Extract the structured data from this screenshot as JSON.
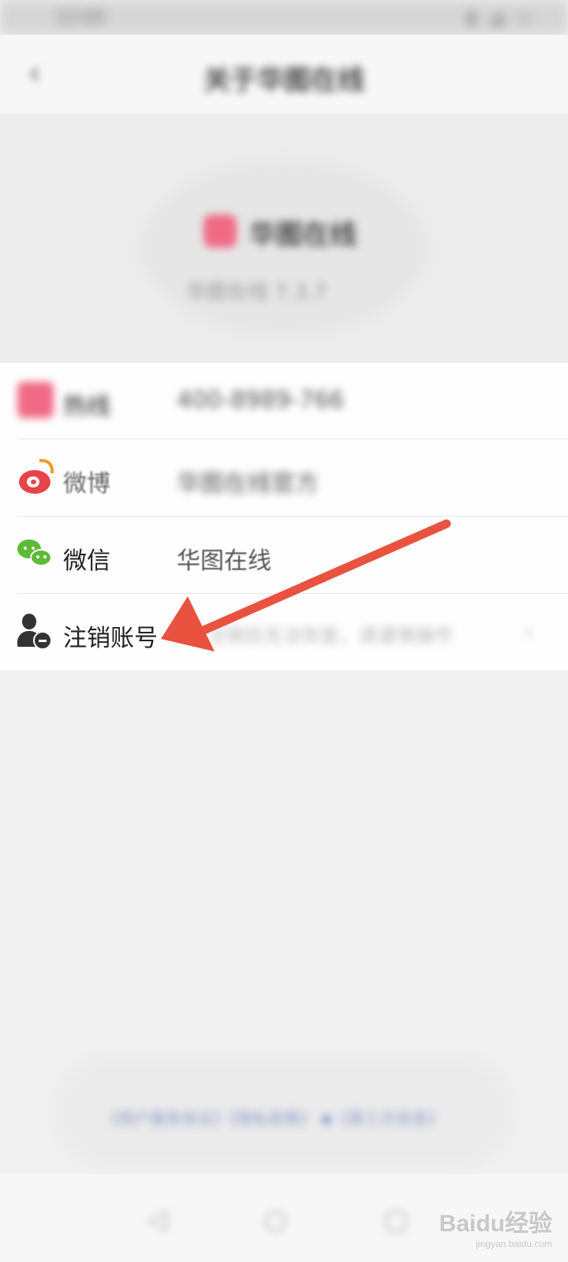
{
  "status_bar": {
    "time": "12:00",
    "icons": "▮ ◢ ▭"
  },
  "app_bar": {
    "back_glyph": "‹",
    "title": "关于华图在线"
  },
  "hero": {
    "app_name": "华图在线",
    "version": "华图在线 7.3.7"
  },
  "list": {
    "rows": [
      {
        "label": "热线",
        "value": "400-8989-766"
      },
      {
        "label": "微博",
        "value": "华图在线官方"
      },
      {
        "label": "微信",
        "value": "华图在线"
      },
      {
        "label": "注销账号",
        "hint": "注销后无法恢复，请谨慎操作",
        "chevron": "›"
      }
    ]
  },
  "footer": {
    "link_text": "《用户服务协议》《隐私政策》 ◆《第三方信息》"
  },
  "nav_bar": {
    "back": "◁",
    "home": "○",
    "recent": "▢"
  },
  "watermark": {
    "main": "Baidu经验",
    "sub": "jingyan.baidu.com"
  },
  "colors": {
    "arrow": "#e8523f",
    "weibo": "#e9434a",
    "wechat": "#5dbb37",
    "logo": "#f06a86"
  }
}
